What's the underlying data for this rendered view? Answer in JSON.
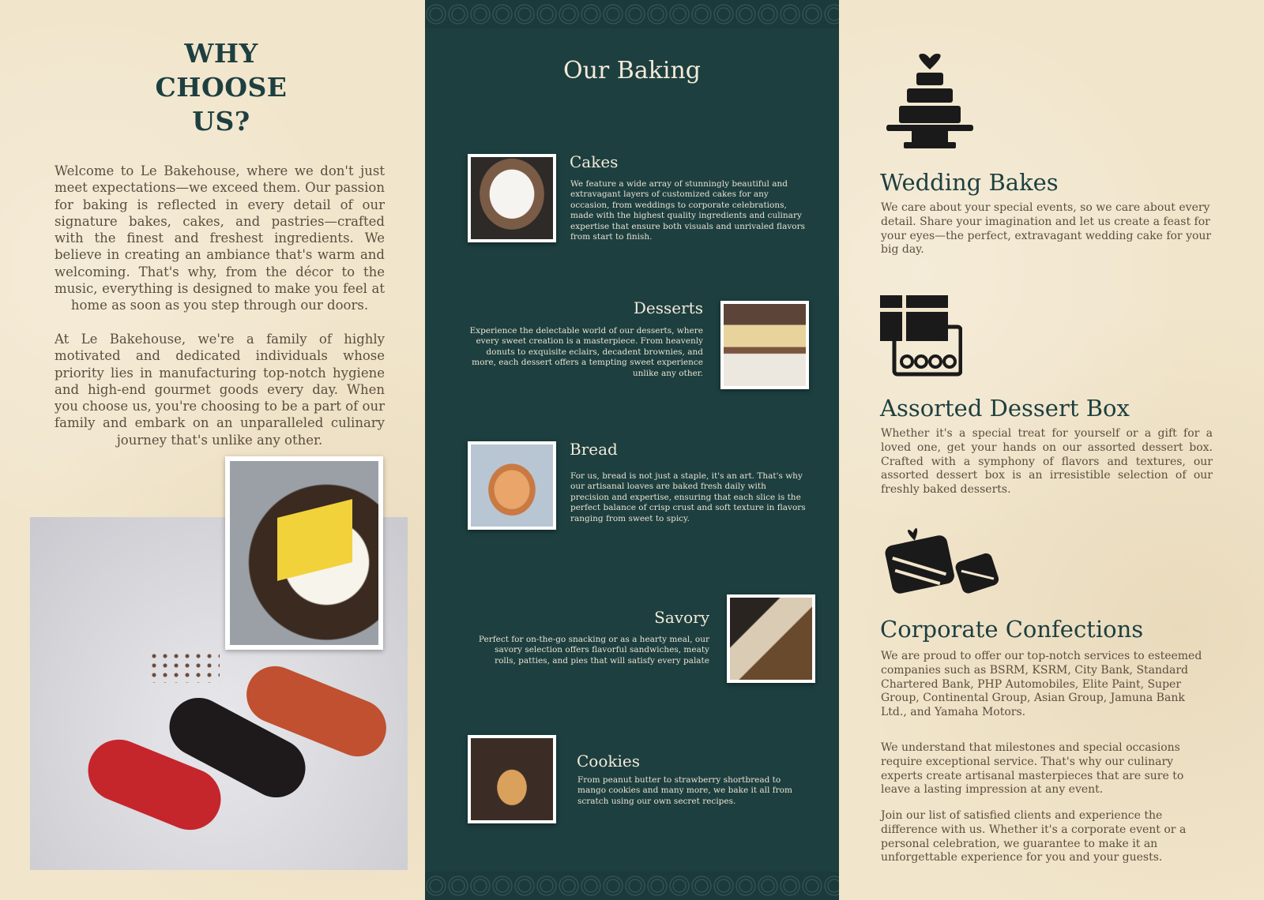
{
  "left": {
    "heading_line1": "WHY",
    "heading_line2": "CHOOSE",
    "heading_line3": "US?",
    "paragraph1": "Welcome to Le Bakehouse, where we don't just meet expectations—we exceed them. Our passion for baking is reflected in every detail of our signature bakes, cakes, and pastries—crafted with the finest and freshest ingredients. We believe in creating an ambiance that's warm and welcoming. That's why, from the décor to the music, everything is designed to make you feel at home as soon as you step through our doors.",
    "paragraph2": "At Le Bakehouse, we're a family of highly motivated and dedicated individuals whose priority lies in manufacturing top-notch hygiene and high-end gourmet goods every day. When you choose us, you're choosing to be a part of our family and embark on an unparalleled culinary journey that's unlike any other."
  },
  "middle": {
    "title": "Our Baking",
    "items": [
      {
        "title": "Cakes",
        "text": "We feature a wide array of stunningly beautiful and extravagant layers of customized cakes for any occasion, from weddings to corporate celebrations, made with the highest quality ingredients and culinary expertise that ensure both visuals and unrivaled flavors from start to finish."
      },
      {
        "title": "Desserts",
        "text": "Experience the delectable world of our desserts, where every sweet creation is a masterpiece. From heavenly donuts to exquisite eclairs, decadent brownies, and more, each dessert offers a tempting sweet experience unlike any other."
      },
      {
        "title": "Bread",
        "text": "For us, bread is not just a staple, it's an art. That's why our artisanal loaves are baked fresh daily with precision and expertise, ensuring that each slice is the perfect balance of crisp crust and soft texture in flavors ranging from sweet to spicy."
      },
      {
        "title": "Savory",
        "text": "Perfect for on-the-go snacking or as a hearty meal, our savory selection offers flavorful sandwiches, meaty rolls, patties, and pies that will satisfy every palate"
      },
      {
        "title": "Cookies",
        "text": "From peanut butter to strawberry shortbread to mango cookies and many more, we bake it all from scratch using our own secret recipes."
      }
    ]
  },
  "right": {
    "sections": [
      {
        "title": "Wedding Bakes",
        "icon": "wedding-cake-icon",
        "paragraphs": [
          "We care about your special events, so we care about every detail. Share your imagination and let us create a feast for your eyes—the perfect, extravagant wedding cake for your big day."
        ]
      },
      {
        "title": "Assorted Dessert Box",
        "icon": "dessert-box-icon",
        "paragraphs": [
          "Whether it's a special treat for yourself or a gift for a loved one, get your hands on our assorted dessert box. Crafted with a symphony of flavors and textures, our assorted dessert box is an irresistible selection of our freshly baked desserts."
        ]
      },
      {
        "title": "Corporate Confections",
        "icon": "gift-boxes-icon",
        "paragraphs": [
          "We are proud to offer our top-notch services to esteemed companies such as BSRM, KSRM, City Bank, Standard Chartered Bank, PHP Automobiles, Elite Paint, Super Group, Continental Group, Asian Group, Jamuna Bank Ltd., and Yamaha Motors.",
          "We understand that milestones and special occasions require exceptional service. That's why our culinary experts create artisanal masterpieces that are sure to leave a lasting impression at any event.",
          "Join our list of satisfied clients and experience the difference with us. Whether it's a corporate event or a personal celebration, we guarantee to make it an unforgettable experience for you and your guests."
        ]
      }
    ]
  },
  "colors": {
    "teal": "#1d3f40",
    "paper": "#f1e5cb",
    "cream_text": "#f3ead7",
    "body_text": "#5a4e3f"
  }
}
